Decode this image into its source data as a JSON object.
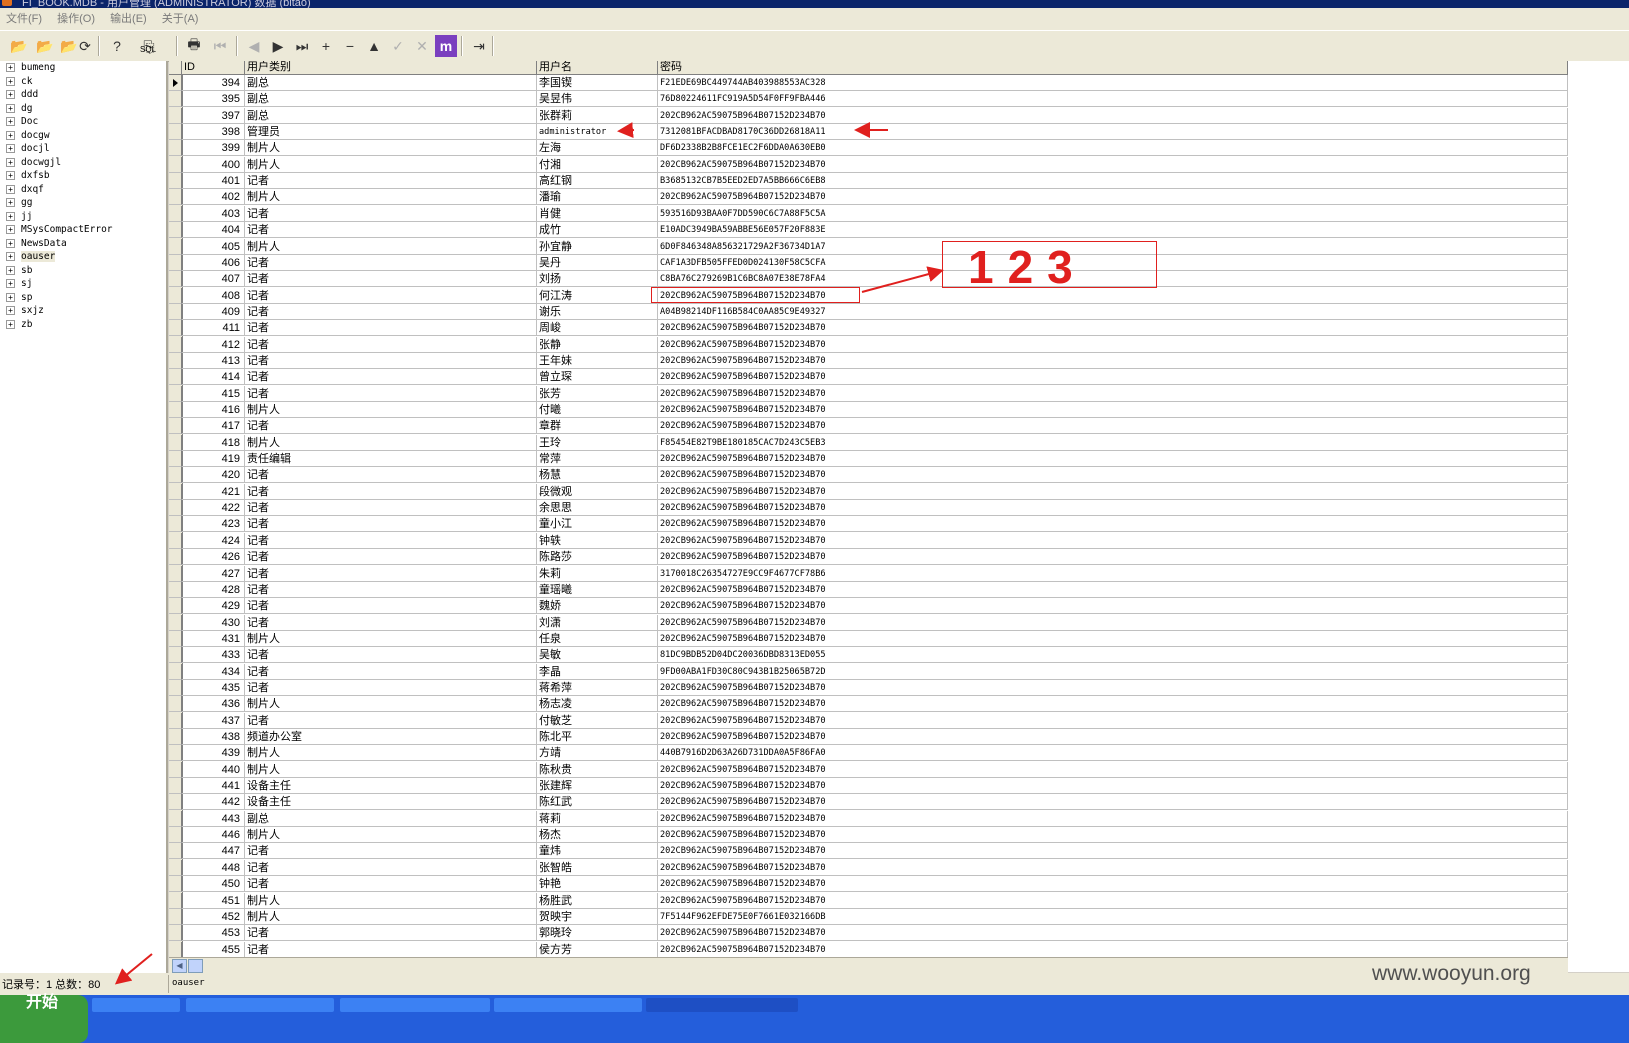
{
  "window": {
    "title": "FI_BOOK.MDB - 用户管理 (ADMINISTRATOR) 数据 (bitao)"
  },
  "menu": [
    {
      "label": "文件(F)"
    },
    {
      "label": "操作(O)"
    },
    {
      "label": "输出(E)"
    },
    {
      "label": "关于(A)"
    }
  ],
  "toolbar": {
    "sql_label": "SQL",
    "buttons": [
      {
        "icon": "open-folder-icon",
        "glyph": "📂"
      },
      {
        "icon": "open-dropdown-icon",
        "glyph": "📂"
      },
      {
        "icon": "folder-up-icon",
        "glyph": "📂"
      },
      {
        "icon": "refresh-icon",
        "glyph": "⟳"
      },
      {
        "icon": "sql-query-icon",
        "glyph": "?"
      },
      {
        "icon": "copy-icon",
        "glyph": "⎘"
      },
      {
        "icon": "print-icon",
        "glyph": "🖶"
      },
      {
        "icon": "first-record-icon",
        "glyph": "⏮"
      },
      {
        "icon": "prior-record-icon",
        "glyph": "◀"
      },
      {
        "icon": "next-record-icon",
        "glyph": "▶"
      },
      {
        "icon": "last-record-icon",
        "glyph": "⏭"
      },
      {
        "icon": "insert-record-icon",
        "glyph": "+"
      },
      {
        "icon": "delete-record-icon",
        "glyph": "−"
      },
      {
        "icon": "edit-record-icon",
        "glyph": "▲"
      },
      {
        "icon": "post-record-icon",
        "glyph": "✓"
      },
      {
        "icon": "cancel-record-icon",
        "glyph": "✕"
      },
      {
        "icon": "app-logo-icon",
        "glyph": "m"
      },
      {
        "icon": "exit-icon",
        "glyph": "⇥"
      }
    ]
  },
  "tree": {
    "selected": "oauser",
    "items": [
      "bumeng",
      "ck",
      "ddd",
      "dg",
      "Doc",
      "docgw",
      "docjl",
      "docwgjl",
      "dxfsb",
      "dxqf",
      "gg",
      "jj",
      "MSysCompactError",
      "NewsData",
      "oauser",
      "sb",
      "sj",
      "sp",
      "sxjz",
      "zb"
    ]
  },
  "grid": {
    "columns": [
      "ID",
      "用户类别",
      "用户名",
      "密码"
    ],
    "rows": [
      [
        "394",
        "副总",
        "李国锲",
        "F21EDE69BC449744AB403988553AC328"
      ],
      [
        "395",
        "副总",
        "吴昱伟",
        "76D80224611FC919A5D54F0FF9FBA446"
      ],
      [
        "397",
        "副总",
        "张群莉",
        "202CB962AC59075B964B07152D234B70"
      ],
      [
        "398",
        "管理员",
        "administrator",
        "7312081BFACDBAD8170C36DD26818A11"
      ],
      [
        "399",
        "制片人",
        "左海",
        "DF6D2338B2B8FCE1EC2F6DDA0A630EB0"
      ],
      [
        "400",
        "制片人",
        "付湘",
        "202CB962AC59075B964B07152D234B70"
      ],
      [
        "401",
        "记者",
        "高红钢",
        "B3685132CB7B5EED2ED7A5BB666C6EB8"
      ],
      [
        "402",
        "制片人",
        "潘瑜",
        "202CB962AC59075B964B07152D234B70"
      ],
      [
        "403",
        "记者",
        "肖健",
        "593516D93BAA0F7DD590C6C7A88F5C5A"
      ],
      [
        "404",
        "记者",
        "成竹",
        "E10ADC3949BA59ABBE56E057F20F883E"
      ],
      [
        "405",
        "制片人",
        "孙宜静",
        "6D0F846348A856321729A2F36734D1A7"
      ],
      [
        "406",
        "记者",
        "吴丹",
        "CAF1A3DFB505FFED0D024130F58C5CFA"
      ],
      [
        "407",
        "记者",
        "刘扬",
        "C8BA76C279269B1C6BC8A07E38E78FA4"
      ],
      [
        "408",
        "记者",
        "何江涛",
        "202CB962AC59075B964B07152D234B70"
      ],
      [
        "409",
        "记者",
        "谢乐",
        "A04B98214DF116B584C0AA85C9E49327"
      ],
      [
        "411",
        "记者",
        "周峻",
        "202CB962AC59075B964B07152D234B70"
      ],
      [
        "412",
        "记者",
        "张静",
        "202CB962AC59075B964B07152D234B70"
      ],
      [
        "413",
        "记者",
        "王年妹",
        "202CB962AC59075B964B07152D234B70"
      ],
      [
        "414",
        "记者",
        "曾立琛",
        "202CB962AC59075B964B07152D234B70"
      ],
      [
        "415",
        "记者",
        "张芳",
        "202CB962AC59075B964B07152D234B70"
      ],
      [
        "416",
        "制片人",
        "付曦",
        "202CB962AC59075B964B07152D234B70"
      ],
      [
        "417",
        "记者",
        "章群",
        "202CB962AC59075B964B07152D234B70"
      ],
      [
        "418",
        "制片人",
        "王玲",
        "F85454E82T9BE180185CAC7D243C5EB3"
      ],
      [
        "419",
        "责任编辑",
        "常萍",
        "202CB962AC59075B964B07152D234B70"
      ],
      [
        "420",
        "记者",
        "杨慧",
        "202CB962AC59075B964B07152D234B70"
      ],
      [
        "421",
        "记者",
        "段微观",
        "202CB962AC59075B964B07152D234B70"
      ],
      [
        "422",
        "记者",
        "余思思",
        "202CB962AC59075B964B07152D234B70"
      ],
      [
        "423",
        "记者",
        "童小江",
        "202CB962AC59075B964B07152D234B70"
      ],
      [
        "424",
        "记者",
        "钟轶",
        "202CB962AC59075B964B07152D234B70"
      ],
      [
        "426",
        "记者",
        "陈路莎",
        "202CB962AC59075B964B07152D234B70"
      ],
      [
        "427",
        "记者",
        "朱莉",
        "3170018C26354727E9CC9F4677CF78B6"
      ],
      [
        "428",
        "记者",
        "童瑶曦",
        "202CB962AC59075B964B07152D234B70"
      ],
      [
        "429",
        "记者",
        "魏娇",
        "202CB962AC59075B964B07152D234B70"
      ],
      [
        "430",
        "记者",
        "刘潇",
        "202CB962AC59075B964B07152D234B70"
      ],
      [
        "431",
        "制片人",
        "任泉",
        "202CB962AC59075B964B07152D234B70"
      ],
      [
        "433",
        "记者",
        "吴敏",
        "81DC9BDB52D04DC20036DBD8313ED055"
      ],
      [
        "434",
        "记者",
        "李晶",
        "9FD00ABA1FD30C80C943B1B25065B72D"
      ],
      [
        "435",
        "记者",
        "蒋希萍",
        "202CB962AC59075B964B07152D234B70"
      ],
      [
        "436",
        "制片人",
        "杨志凌",
        "202CB962AC59075B964B07152D234B70"
      ],
      [
        "437",
        "记者",
        "付敏芝",
        "202CB962AC59075B964B07152D234B70"
      ],
      [
        "438",
        "频道办公室",
        "陈北平",
        "202CB962AC59075B964B07152D234B70"
      ],
      [
        "439",
        "制片人",
        "方靖",
        "440B7916D2D63A26D731DDA0A5F86FA0"
      ],
      [
        "440",
        "制片人",
        "陈秋贵",
        "202CB962AC59075B964B07152D234B70"
      ],
      [
        "441",
        "设备主任",
        "张建辉",
        "202CB962AC59075B964B07152D234B70"
      ],
      [
        "442",
        "设备主任",
        "陈红武",
        "202CB962AC59075B964B07152D234B70"
      ],
      [
        "443",
        "副总",
        "蒋莉",
        "202CB962AC59075B964B07152D234B70"
      ],
      [
        "446",
        "制片人",
        "杨杰",
        "202CB962AC59075B964B07152D234B70"
      ],
      [
        "447",
        "记者",
        "童炜",
        "202CB962AC59075B964B07152D234B70"
      ],
      [
        "448",
        "记者",
        "张智皓",
        "202CB962AC59075B964B07152D234B70"
      ],
      [
        "450",
        "记者",
        "钟艳",
        "202CB962AC59075B964B07152D234B70"
      ],
      [
        "451",
        "制片人",
        "杨胜武",
        "202CB962AC59075B964B07152D234B70"
      ],
      [
        "452",
        "制片人",
        "贺映宇",
        "7F5144F962EFDE75E0F7661E032166DB"
      ],
      [
        "453",
        "记者",
        "郭晓玲",
        "202CB962AC59075B964B07152D234B70"
      ],
      [
        "455",
        "记者",
        "侯方芳",
        "202CB962AC59075B964B07152D234B70"
      ]
    ]
  },
  "annotation": {
    "text": "123",
    "color": "#e0201e"
  },
  "status": {
    "record_text": "记录号：1 总数：80",
    "table_name": "oauser"
  },
  "taskbar": {
    "start_label": "开始"
  },
  "watermark": "www.wooyun.org"
}
